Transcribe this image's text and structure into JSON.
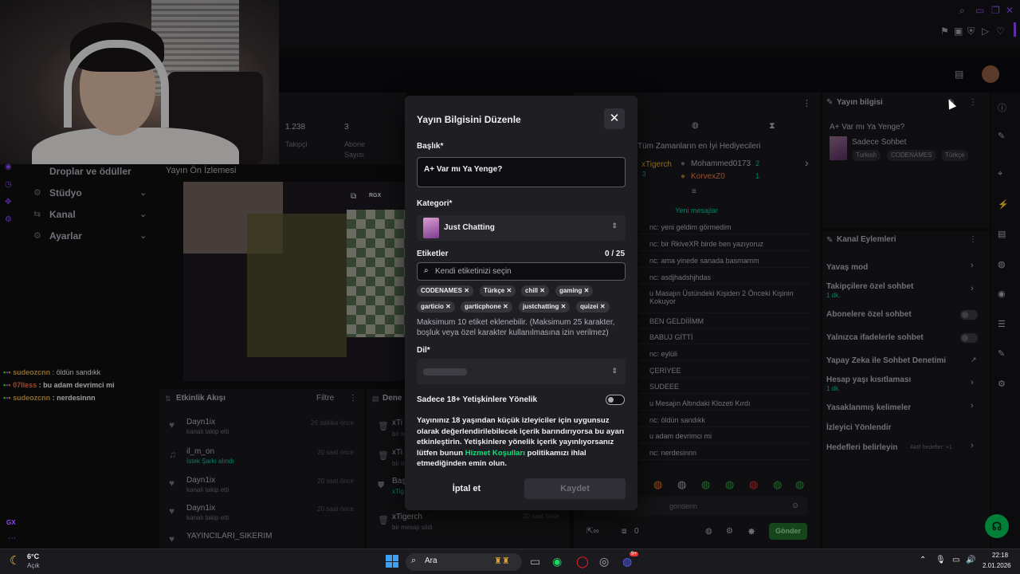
{
  "topbar": {
    "icons": [
      "search-icon",
      "window-restore-icon",
      "window-maximize-icon",
      "close-icon"
    ],
    "sub_icons": [
      "bookmark-icon",
      "capture-icon",
      "shield-icon",
      "play-icon",
      "heart-icon"
    ]
  },
  "stats": {
    "followers_value": "1.238",
    "followers_label": "Takipçi",
    "subs_value": "3",
    "subs_label_1": "Abone",
    "subs_label_2": "Sayısı"
  },
  "left_nav": {
    "drops": "Droplar ve ödüller",
    "items": [
      {
        "label": "Stüdyo",
        "icon": "studio-icon"
      },
      {
        "label": "Kanal",
        "icon": "channel-icon"
      },
      {
        "label": "Ayarlar",
        "icon": "gear-icon"
      }
    ]
  },
  "preview": {
    "label": "Yayın Ön İzlemesi",
    "badge": "RGX"
  },
  "left_chat": [
    {
      "user": "sudeozcnn",
      "msg": " : öldün sandıkk",
      "color": "#d9a53a"
    },
    {
      "user": "07lless",
      "msg": " : bu adam devrimci mi",
      "color": "#ff6a3d"
    },
    {
      "user": "sudeozcnn",
      "msg": " : nerdesinnn",
      "color": "#d9a53a"
    }
  ],
  "feed": {
    "title": "Etkinlik Akışı",
    "filter": "Filtre",
    "rows": [
      {
        "name": "Dayn1ix",
        "sub": "kanalı takip etti",
        "time": "26 dakika önce"
      },
      {
        "name": "il_m_on",
        "sub": "İstek Şarkı alındı",
        "time": "20 saat önce"
      },
      {
        "name": "Dayn1ix",
        "sub": "kanalı takip etti",
        "time": "20 saat önce"
      },
      {
        "name": "Dayn1ix",
        "sub": "kanalı takip etti",
        "time": "20 saat önce"
      },
      {
        "name": "YAYINCILARI_SIKERIM",
        "sub": "",
        "time": ""
      }
    ]
  },
  "deneme": {
    "title": "Dene",
    "rows": [
      {
        "name": "xTi",
        "sub": "bir n"
      },
      {
        "name": "xTi",
        "sub": "bir n"
      },
      {
        "name": "Baş",
        "sub": "xTig"
      },
      {
        "name": "xTigerch",
        "sub": "bir mesajı sildi",
        "time": "20 saat önce"
      }
    ]
  },
  "chat": {
    "leaderboard_title": "Tüm Zamanların en İyi Hediyecileri",
    "top1": "xTigerch",
    "top1_count": "3",
    "top2": "Mohammed0173",
    "top2_count": "2",
    "top3": "KorvexZ0",
    "top3_count": "1",
    "new_messages": "Yeni mesajlar",
    "lines": [
      "nc: yeni geldim görmedim",
      "nc: bir RkiveXR birde ben yazıyoruz",
      "nc: ama yinede sanada basmamm",
      "nc: asdjhadshjhdas",
      "u Masajın Üstündeki Kişiden 2 Önceki Kişinin",
      "BEN GELDİİİMM",
      "BABUJ GİTTİ",
      "nc: eylüli",
      "ÇERİYEE",
      "SUDEEE",
      "u Mesajın Altındaki Klozeti Kırdı",
      "nc: öldün sandıkk",
      "u adam devrimci mi",
      "nc: nerdesinnn"
    ],
    "continuation": "Kokuyor",
    "input_placeholder": "gönderin",
    "points": "0",
    "send_button": "Gönder"
  },
  "info_panel": {
    "title": "Yayın bilgisi",
    "stream_title": "A+ Var mı Ya Yenge?",
    "category": "Sadece Sohbet",
    "tags": [
      "Turkish",
      "CODENAMES",
      "Türkçe"
    ]
  },
  "channel_actions": {
    "title": "Kanal Eylemleri",
    "items": [
      {
        "label": "Yavaş mod",
        "sub": "",
        "control": "chevron"
      },
      {
        "label": "Takipçilere özel sohbet",
        "sub": "1 dk.",
        "control": "chevron"
      },
      {
        "label": "Abonelere özel sohbet",
        "sub": "",
        "control": "toggle"
      },
      {
        "label": "Yalnızca ifadelerle sohbet",
        "sub": "",
        "control": "toggle"
      },
      {
        "label": "Yapay Zeka ile Sohbet Denetimi",
        "sub": "",
        "control": "external"
      },
      {
        "label": "Hesap yaşı kısıtlaması",
        "sub": "1 dk.",
        "control": "chevron"
      },
      {
        "label": "Yasaklanmış kelimeler",
        "sub": "",
        "control": "chevron"
      },
      {
        "label": "İzleyici Yönlendir",
        "sub": "",
        "control": "none"
      },
      {
        "label": "Hedefleri belirleyin",
        "sub": "",
        "control": "chevron"
      }
    ],
    "goals_badge": "Aktif hedefler: +1"
  },
  "modal": {
    "title": "Yayın Bilgisini Düzenle",
    "title_label": "Başlık*",
    "title_value": "A+ Var mı Ya Yenge?",
    "category_label": "Kategori*",
    "category_value": "Just Chatting",
    "tags_label": "Etiketler",
    "tags_count": "0 / 25",
    "tags_placeholder": "Kendi etiketinizi seçin",
    "tags": [
      "CODENAMES",
      "Türkçe",
      "chill",
      "gaming",
      "garticio",
      "garticphone",
      "justchatting",
      "quizei"
    ],
    "tags_help": "Maksimum 10 etiket eklenebilir. (Maksimum 25 karakter, boşluk veya özel karakter kullanılmasına izin verilmez)",
    "lang_label": "Dil*",
    "mature_label": "Sadece 18+ Yetişkinlere Yönelik",
    "mature_on": false,
    "mature_body_1": "Yayınınız 18 yaşından küçük izleyiciler için uygunsuz olarak değerlendirilebilecek içerik barındırıyorsa bu ayarı etkinleştirin. Yetişkinlere yönelik içerik yayınlıyorsanız lütfen bunun ",
    "mature_link": "Hizmet Koşulları",
    "mature_body_2": " politikamızı ihlal etmediğinden emin olun.",
    "cancel": "İptal et",
    "save": "Kaydet"
  },
  "taskbar": {
    "weather_temp": "6°C",
    "weather_desc": "Açık",
    "search": "Ara",
    "time": "22:18",
    "date": "2.01.2026",
    "discord_badge": "9+",
    "left_badge": "GX"
  },
  "colors": {
    "accent": "#9147ff",
    "kick_green": "#00e87a",
    "modal_bg": "#1f1f23"
  }
}
